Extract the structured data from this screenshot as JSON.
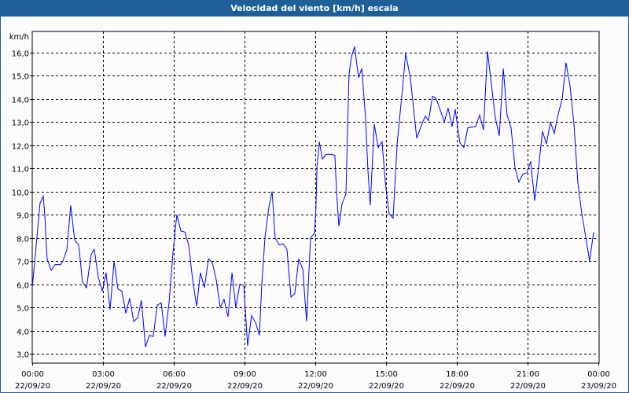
{
  "window": {
    "title": "Velocidad del viento [km/h] escala"
  },
  "chart_data": {
    "type": "line",
    "title": "Velocidad del viento [km/h] escala",
    "ylabel": "km/h",
    "xlabel": "",
    "ylim": [
      2.6,
      16.9
    ],
    "xlim_hours": [
      0,
      24
    ],
    "grid": true,
    "y_ticks": [
      {
        "value": 3,
        "label": "3,0"
      },
      {
        "value": 4,
        "label": "4,0"
      },
      {
        "value": 5,
        "label": "5,0"
      },
      {
        "value": 6,
        "label": "6,0"
      },
      {
        "value": 7,
        "label": "7,0"
      },
      {
        "value": 8,
        "label": "8,0"
      },
      {
        "value": 9,
        "label": "9,0"
      },
      {
        "value": 10,
        "label": "10,0"
      },
      {
        "value": 11,
        "label": "11,0"
      },
      {
        "value": 12,
        "label": "12,0"
      },
      {
        "value": 13,
        "label": "13,0"
      },
      {
        "value": 14,
        "label": "14,0"
      },
      {
        "value": 15,
        "label": "15,0"
      },
      {
        "value": 16,
        "label": "16,0"
      }
    ],
    "x_ticks": [
      {
        "hours": 0,
        "time": "00:00",
        "date": "22/09/20"
      },
      {
        "hours": 3,
        "time": "03:00",
        "date": "22/09/20"
      },
      {
        "hours": 6,
        "time": "06:00",
        "date": "22/09/20"
      },
      {
        "hours": 9,
        "time": "09:00",
        "date": "22/09/20"
      },
      {
        "hours": 12,
        "time": "12:00",
        "date": "22/09/20"
      },
      {
        "hours": 15,
        "time": "15:00",
        "date": "22/09/20"
      },
      {
        "hours": 18,
        "time": "18:00",
        "date": "22/09/20"
      },
      {
        "hours": 21,
        "time": "21:00",
        "date": "22/09/20"
      },
      {
        "hours": 24,
        "time": "00:00",
        "date": "23/09/20"
      }
    ],
    "series": [
      {
        "name": "Velocidad del viento",
        "color": "#0000ff",
        "x_hours": [
          0.0,
          0.17,
          0.33,
          0.47,
          0.53,
          0.63,
          0.8,
          0.97,
          1.2,
          1.3,
          1.47,
          1.63,
          1.8,
          1.97,
          2.13,
          2.3,
          2.5,
          2.63,
          2.8,
          2.97,
          3.13,
          3.3,
          3.47,
          3.63,
          3.8,
          3.97,
          4.13,
          4.3,
          4.47,
          4.63,
          4.8,
          4.97,
          5.13,
          5.3,
          5.47,
          5.63,
          5.8,
          5.97,
          6.13,
          6.3,
          6.47,
          6.63,
          6.8,
          6.97,
          7.13,
          7.3,
          7.47,
          7.63,
          7.8,
          7.97,
          8.13,
          8.3,
          8.47,
          8.63,
          8.8,
          8.97,
          9.13,
          9.3,
          9.47,
          9.63,
          9.73,
          9.87,
          10.03,
          10.17,
          10.3,
          10.47,
          10.63,
          10.8,
          10.97,
          11.13,
          11.3,
          11.47,
          11.63,
          11.8,
          11.97,
          12.03,
          12.07,
          12.17,
          12.3,
          12.47,
          12.7,
          12.83,
          12.9,
          13.0,
          13.13,
          13.3,
          13.43,
          13.53,
          13.67,
          13.83,
          13.97,
          14.13,
          14.23,
          14.33,
          14.5,
          14.67,
          14.83,
          14.97,
          15.13,
          15.3,
          15.47,
          15.7,
          15.83,
          16.03,
          16.3,
          16.53,
          16.67,
          16.8,
          16.97,
          17.13,
          17.47,
          17.63,
          17.8,
          17.93,
          18.13,
          18.3,
          18.47,
          18.8,
          18.97,
          19.13,
          19.3,
          19.47,
          19.63,
          19.8,
          19.97,
          20.13,
          20.3,
          20.47,
          20.63,
          20.8,
          20.97,
          21.13,
          21.3,
          21.47,
          21.63,
          21.8,
          21.97,
          22.13,
          22.3,
          22.47,
          22.63,
          22.8,
          22.97,
          23.13,
          23.3,
          23.47,
          23.63,
          23.8
        ],
        "values": [
          5.85,
          7.7,
          9.5,
          9.8,
          9.0,
          7.1,
          6.6,
          6.85,
          6.85,
          7.0,
          7.5,
          9.4,
          7.9,
          7.7,
          6.1,
          5.85,
          7.3,
          7.5,
          6.3,
          5.7,
          6.5,
          4.9,
          7.0,
          5.8,
          5.7,
          4.75,
          5.4,
          4.4,
          4.55,
          5.3,
          3.3,
          3.8,
          3.75,
          5.1,
          5.2,
          3.75,
          5.2,
          7.4,
          9.0,
          8.3,
          8.25,
          7.7,
          6.2,
          5.05,
          6.5,
          5.85,
          7.1,
          6.95,
          6.2,
          5.0,
          5.35,
          4.6,
          6.5,
          5.0,
          6.0,
          5.95,
          3.35,
          4.65,
          4.35,
          3.8,
          5.95,
          8.05,
          9.3,
          10.0,
          8.0,
          7.7,
          7.75,
          7.5,
          5.45,
          5.6,
          7.1,
          6.65,
          4.4,
          8.0,
          8.2,
          9.35,
          11.05,
          12.15,
          11.4,
          11.6,
          11.6,
          11.55,
          10.0,
          8.5,
          9.45,
          9.9,
          15.05,
          15.8,
          16.25,
          14.9,
          15.3,
          13.2,
          10.95,
          9.4,
          12.9,
          11.9,
          12.15,
          10.4,
          9.05,
          8.85,
          12.05,
          14.45,
          15.95,
          14.9,
          12.3,
          12.95,
          13.25,
          13.05,
          14.1,
          14.0,
          13.0,
          13.6,
          12.8,
          13.55,
          12.1,
          11.9,
          12.75,
          12.8,
          13.3,
          12.65,
          16.05,
          14.6,
          13.2,
          12.4,
          15.3,
          13.3,
          12.75,
          11.0,
          10.4,
          10.75,
          10.8,
          11.3,
          9.6,
          11.05,
          12.6,
          12.05,
          13.0,
          12.5,
          13.35,
          14.0,
          15.55,
          14.55,
          12.85,
          10.4,
          9.05,
          8.0,
          7.0,
          8.25
        ]
      }
    ]
  }
}
